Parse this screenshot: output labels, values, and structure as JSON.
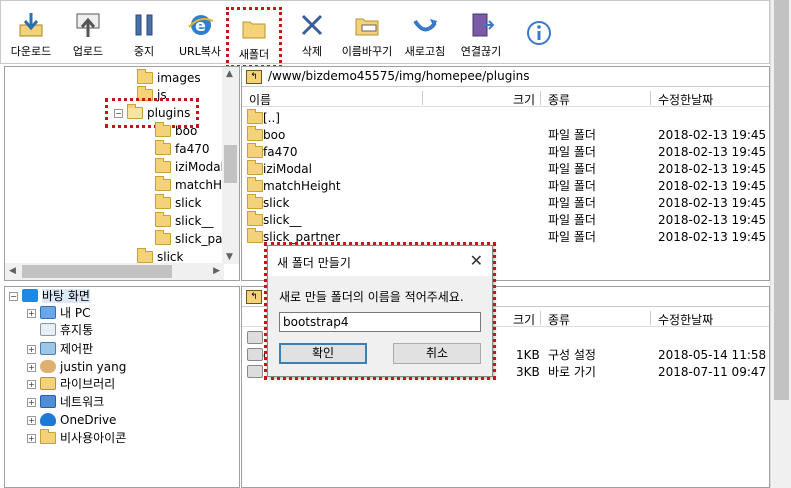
{
  "toolbar": {
    "buttons": [
      {
        "label": "다운로드",
        "icon": "download-icon"
      },
      {
        "label": "업로드",
        "icon": "upload-icon"
      },
      {
        "label": "중지",
        "icon": "pause-icon"
      },
      {
        "label": "URL복사",
        "icon": "url-copy-icon"
      },
      {
        "label": "새폴더",
        "icon": "new-folder-icon"
      },
      {
        "label": "삭제",
        "icon": "delete-x-icon"
      },
      {
        "label": "이름바꾸기",
        "icon": "rename-icon"
      },
      {
        "label": "새로고침",
        "icon": "refresh-icon"
      },
      {
        "label": "연결끊기",
        "icon": "disconnect-icon"
      }
    ],
    "info_icon": "info-icon"
  },
  "remote_tree": {
    "items": [
      "images",
      "js",
      "plugins",
      "boo",
      "fa470",
      "iziModal",
      "matchH",
      "slick",
      "slick__",
      "slick_par",
      "slick"
    ]
  },
  "remote_list": {
    "path": "/www/bizdemo45575/img/homepee/plugins",
    "columns": {
      "name": "이름",
      "size": "크기",
      "type": "종류",
      "modified": "수정한날짜"
    },
    "rows": [
      {
        "name": "[..]",
        "size": "",
        "type": "",
        "modified": ""
      },
      {
        "name": "boo",
        "size": "",
        "type": "파일 폴더",
        "modified": "2018-02-13 19:45"
      },
      {
        "name": "fa470",
        "size": "",
        "type": "파일 폴더",
        "modified": "2018-02-13 19:45"
      },
      {
        "name": "iziModal",
        "size": "",
        "type": "파일 폴더",
        "modified": "2018-02-13 19:45"
      },
      {
        "name": "matchHeight",
        "size": "",
        "type": "파일 폴더",
        "modified": "2018-02-13 19:45"
      },
      {
        "name": "slick",
        "size": "",
        "type": "파일 폴더",
        "modified": "2018-02-13 19:45"
      },
      {
        "name": "slick__",
        "size": "",
        "type": "파일 폴더",
        "modified": "2018-02-13 19:45"
      },
      {
        "name": "slick_partner",
        "size": "",
        "type": "파일 폴더",
        "modified": "2018-02-13 19:45"
      }
    ]
  },
  "local_tree": {
    "items": [
      "바탕 화면",
      "내 PC",
      "휴지통",
      "제어판",
      "justin yang",
      "라이브러리",
      "네트워크",
      "OneDrive",
      "비사용아이콘"
    ]
  },
  "local_list": {
    "columns": {
      "size": "크기",
      "type": "종류",
      "modified": "수정한날짜"
    },
    "rows": [
      {
        "name": "",
        "size": "",
        "type": "",
        "modified": ""
      },
      {
        "name": "d",
        "size": "1KB",
        "type": "구성 설정",
        "modified": "2018-05-14 11:58"
      },
      {
        "name": "",
        "size": "3KB",
        "type": "바로 가기",
        "modified": "2018-07-11 09:47"
      }
    ]
  },
  "dialog": {
    "title": "새 폴더 만들기",
    "close": "✕",
    "message": "새로 만들 폴더의 이름을 적어주세요.",
    "input_value": "bootstrap4",
    "ok_label": "확인",
    "cancel_label": "취소"
  }
}
